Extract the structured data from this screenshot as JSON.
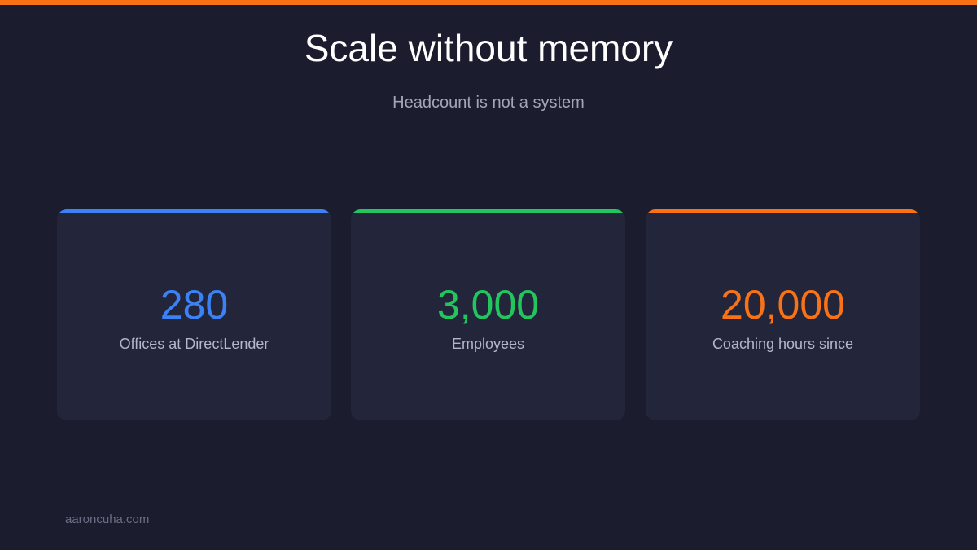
{
  "slide": {
    "title": "Scale without memory",
    "subtitle": "Headcount is not a system",
    "footer": "aaroncuha.com"
  },
  "stats": [
    {
      "value": "280",
      "label": "Offices at DirectLender",
      "accent_color": "#3b82f6"
    },
    {
      "value": "3,000",
      "label": "Employees",
      "accent_color": "#22c55e"
    },
    {
      "value": "20,000",
      "label": "Coaching hours since",
      "accent_color": "#f97316"
    }
  ],
  "colors": {
    "background": "#1b1c2e",
    "card": "#23253a",
    "top_bar": "#f97316"
  }
}
